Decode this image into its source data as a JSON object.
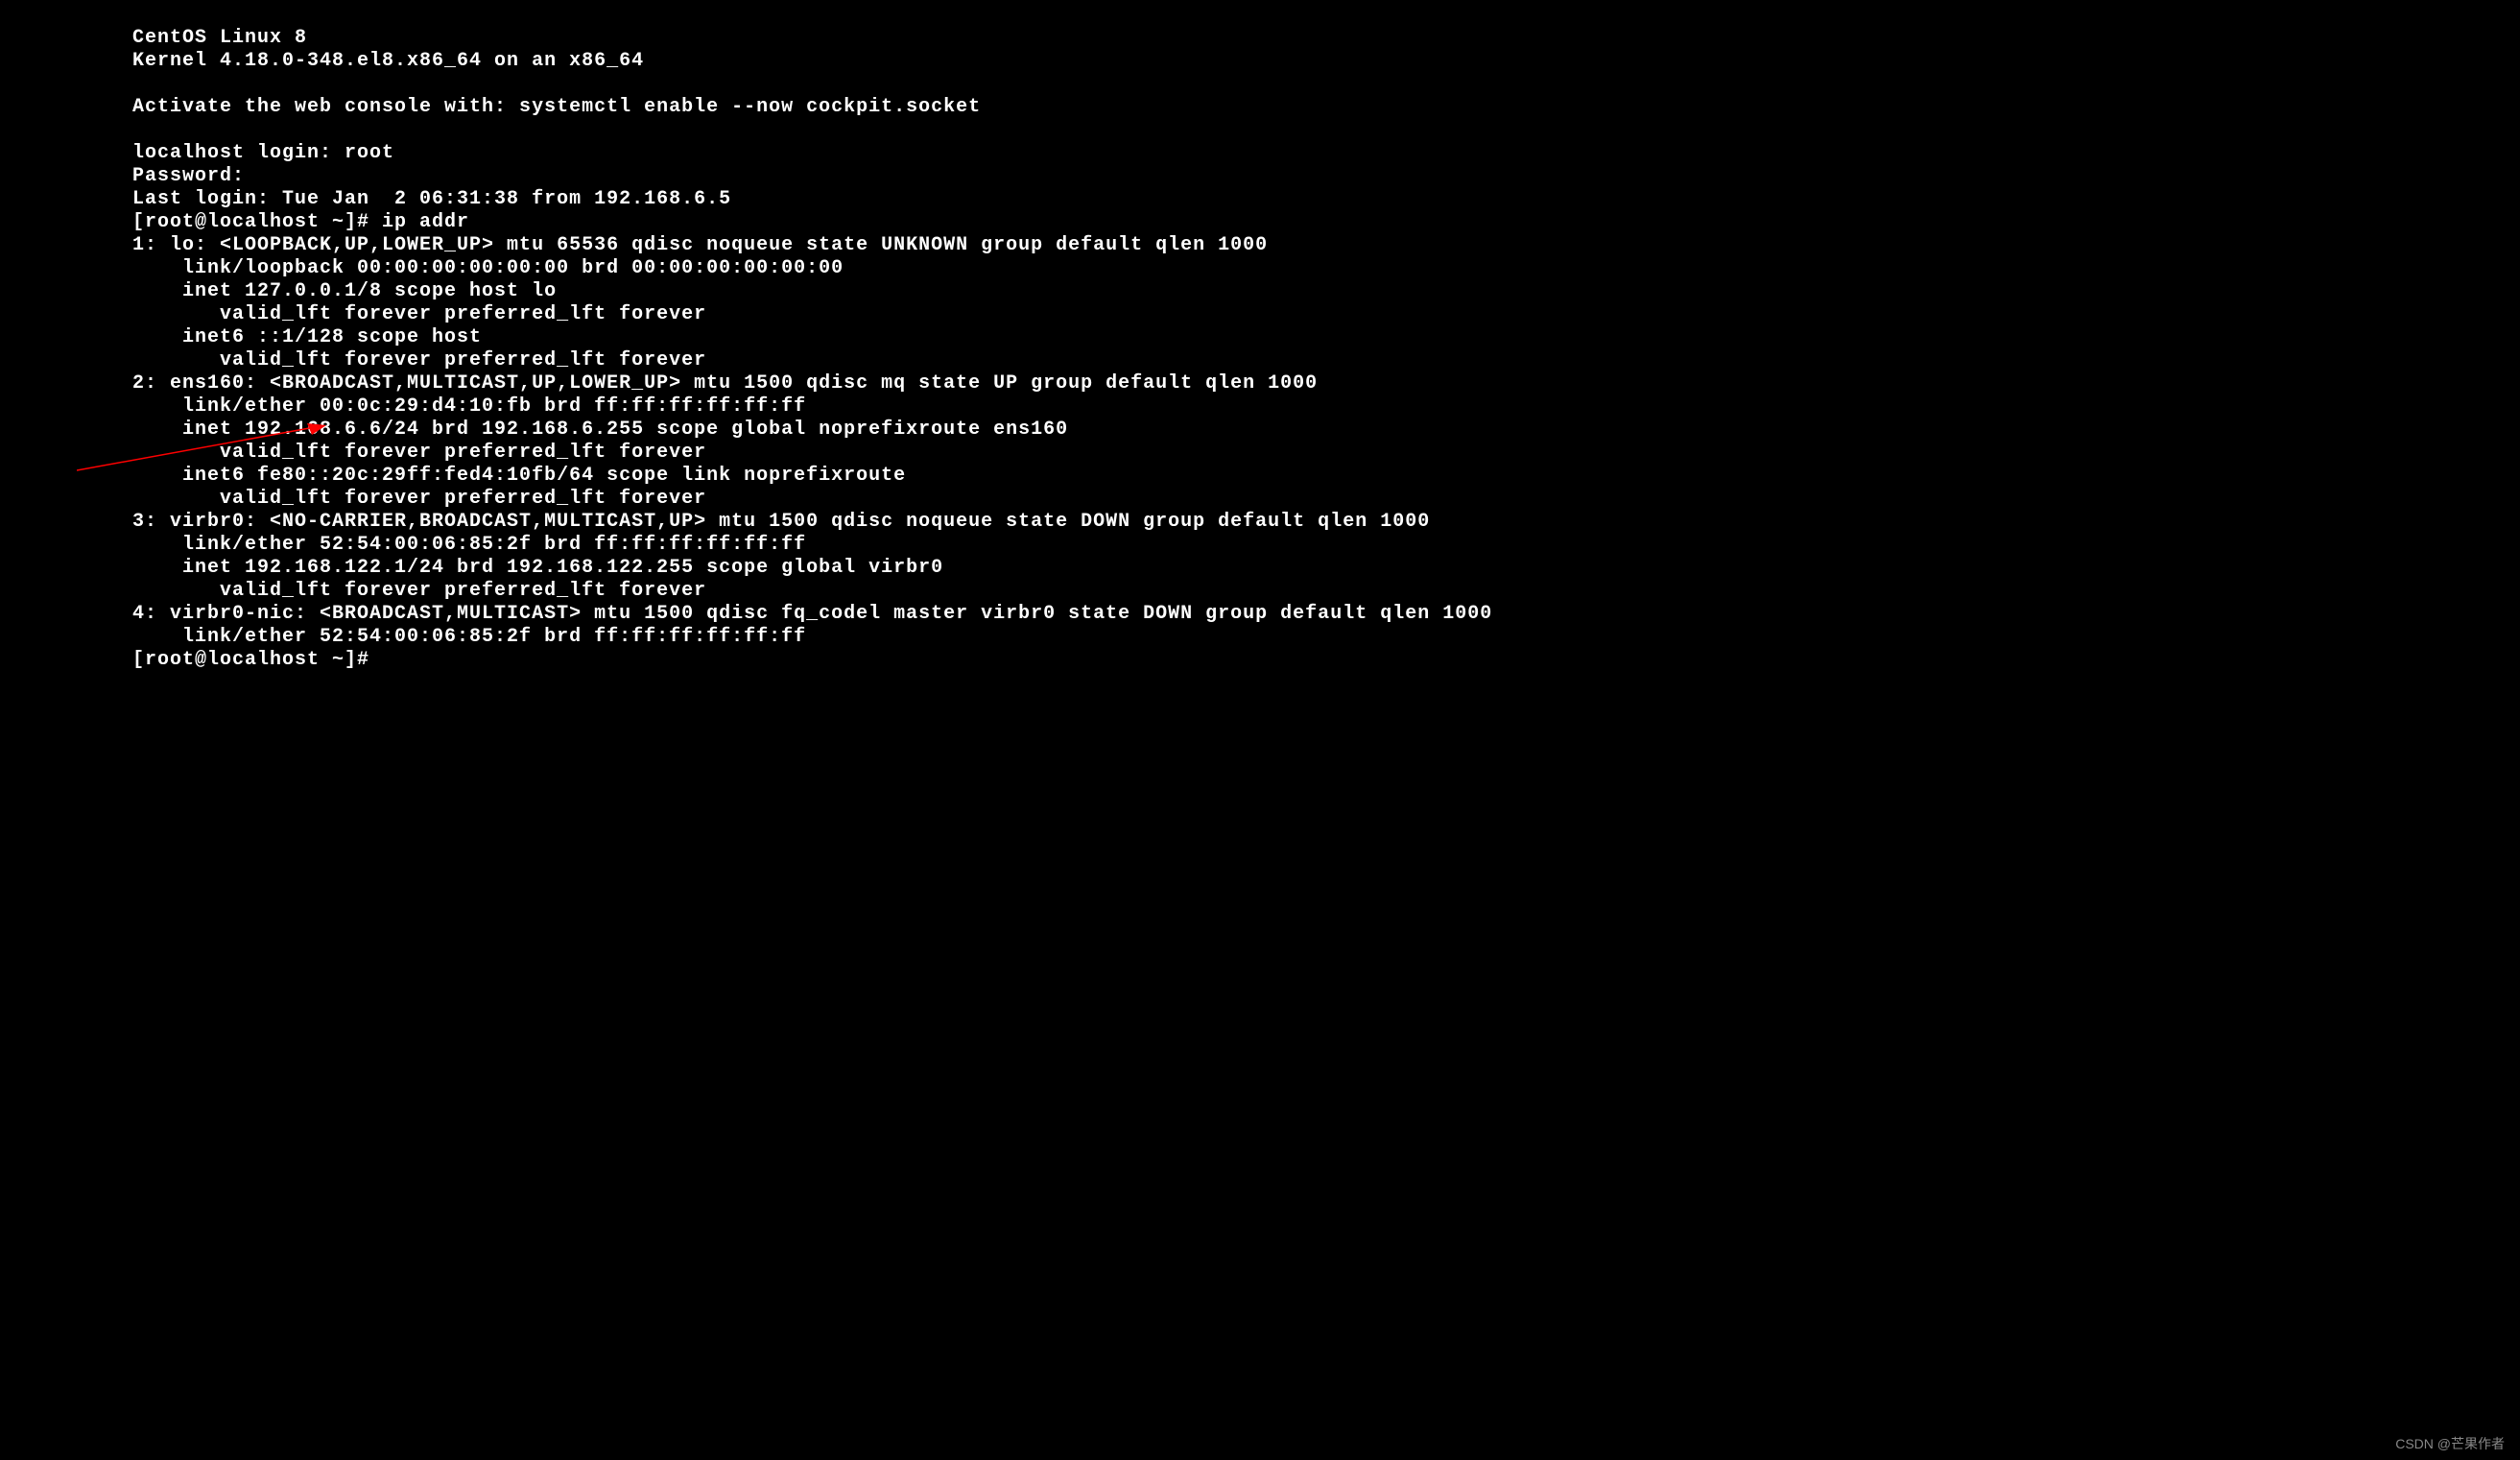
{
  "terminal": {
    "lines": [
      "CentOS Linux 8",
      "Kernel 4.18.0-348.el8.x86_64 on an x86_64",
      "",
      "Activate the web console with: systemctl enable --now cockpit.socket",
      "",
      "localhost login: root",
      "Password:",
      "Last login: Tue Jan  2 06:31:38 from 192.168.6.5",
      "[root@localhost ~]# ip addr",
      "1: lo: <LOOPBACK,UP,LOWER_UP> mtu 65536 qdisc noqueue state UNKNOWN group default qlen 1000",
      "    link/loopback 00:00:00:00:00:00 brd 00:00:00:00:00:00",
      "    inet 127.0.0.1/8 scope host lo",
      "       valid_lft forever preferred_lft forever",
      "    inet6 ::1/128 scope host",
      "       valid_lft forever preferred_lft forever",
      "2: ens160: <BROADCAST,MULTICAST,UP,LOWER_UP> mtu 1500 qdisc mq state UP group default qlen 1000",
      "    link/ether 00:0c:29:d4:10:fb brd ff:ff:ff:ff:ff:ff",
      "    inet 192.168.6.6/24 brd 192.168.6.255 scope global noprefixroute ens160",
      "       valid_lft forever preferred_lft forever",
      "    inet6 fe80::20c:29ff:fed4:10fb/64 scope link noprefixroute",
      "       valid_lft forever preferred_lft forever",
      "3: virbr0: <NO-CARRIER,BROADCAST,MULTICAST,UP> mtu 1500 qdisc noqueue state DOWN group default qlen 1000",
      "    link/ether 52:54:00:06:85:2f brd ff:ff:ff:ff:ff:ff",
      "    inet 192.168.122.1/24 brd 192.168.122.255 scope global virbr0",
      "       valid_lft forever preferred_lft forever",
      "4: virbr0-nic: <BROADCAST,MULTICAST> mtu 1500 qdisc fq_codel master virbr0 state DOWN group default qlen 1000",
      "    link/ether 52:54:00:06:85:2f brd ff:ff:ff:ff:ff:ff",
      "[root@localhost ~]#"
    ]
  },
  "annotation": {
    "arrow_color": "#ff0000"
  },
  "watermark": "CSDN @芒果作者"
}
